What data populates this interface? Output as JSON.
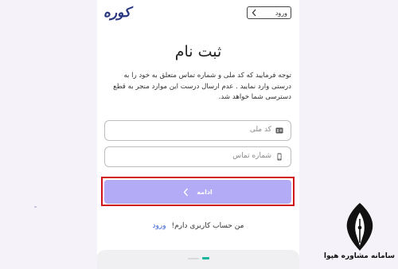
{
  "header": {
    "logo_text": "کوره",
    "login_button": "ورود"
  },
  "form": {
    "title": "ثبت نام",
    "description": "توجه فرمایید که کد ملی و شماره تماس متعلق به خود را به درستی وارد نمایید . عدم ارسال درست این موارد منجر به قطع دسترسی شما خواهد شد.",
    "national_code_placeholder": "کد ملی",
    "phone_placeholder": "شماره تماس",
    "continue_label": "ادامه"
  },
  "footer": {
    "have_account_text": "من حساب کاربری دارم!",
    "login_link": "ورود"
  },
  "watermark": {
    "text": "سامانه مشاوره هپوا"
  },
  "colors": {
    "brand_navy": "#27367f",
    "continue_button": "#b3abf6",
    "highlight_border": "#d0101a",
    "link_blue": "#3a63d8",
    "indicator_green": "#19b69a",
    "page_background": "#f6f2fa"
  },
  "icons": {
    "login_chevron": "chevron-left-icon",
    "continue_chevron": "chevron-left-icon",
    "national_code": "id-card-icon",
    "phone": "phone-icon"
  }
}
